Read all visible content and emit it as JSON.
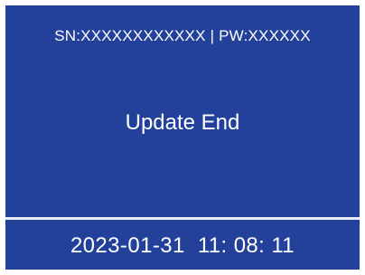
{
  "header": {
    "serial_info": "SN:XXXXXXXXXXXX | PW:XXXXXX"
  },
  "main": {
    "status_message": "Update End"
  },
  "footer": {
    "datetime": "2023-01-31  11: 08: 11"
  },
  "colors": {
    "background": "#23409a",
    "text": "#ffffff",
    "border": "#ffffff",
    "divider": "#e8ecf7"
  }
}
